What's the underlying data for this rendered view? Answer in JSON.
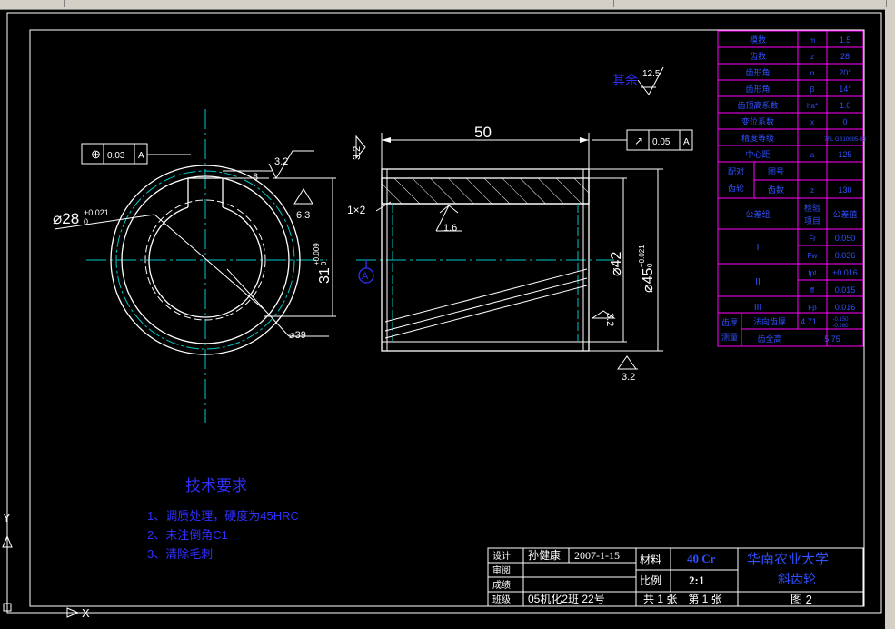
{
  "colors": {
    "background": "#000000",
    "geometry": "#ffffff",
    "centerline": "#00c8c8",
    "table": "#ff00ff",
    "annotation_blue": "#3030ff",
    "table_text": "#3050ff"
  },
  "dimensions": {
    "length": "50",
    "dia28": "⌀28",
    "dia28_tol_upper": "+0.021",
    "dia28_tol_lower": "0",
    "keyway_depth": "31",
    "keyway_tol_upper": "+0.009",
    "keyway_tol_lower": "0",
    "dia42": "⌀42",
    "dia45": "⌀45",
    "dia45_tol_upper": "+0.021",
    "dia45_tol_lower": "0",
    "dia39": "⌀39",
    "keyway_width": "8",
    "chamfer": "1×2"
  },
  "roughness": {
    "rest": "其余",
    "rest_value": "12.5",
    "top": "3.2",
    "left_face": "3.2",
    "keyway": "3.2",
    "keyway_side": "6.3",
    "bore": "1.6",
    "right_face": "3.2",
    "bottom": "3.2"
  },
  "tolerance_frames": {
    "circular_runout": {
      "symbol": "⊕",
      "value": "0.03",
      "datum": "A"
    },
    "runout": {
      "symbol": "↗",
      "value": "0.05",
      "datum": "A"
    }
  },
  "datum_label": "A",
  "gear_params": [
    {
      "label": "模数",
      "sym": "m",
      "val": "1.5"
    },
    {
      "label": "齿数",
      "sym": "z",
      "val": "28"
    },
    {
      "label": "齿形角",
      "sym": "α",
      "val": "20°"
    },
    {
      "label": "齿形角",
      "sym": "β",
      "val": "14°"
    },
    {
      "label": "齿顶高系数",
      "sym": "ha*",
      "val": "1.0"
    },
    {
      "label": "变位系数",
      "sym": "x",
      "val": "0"
    },
    {
      "label": "精度等级",
      "sym": "",
      "val": "7FL GB10095-88"
    },
    {
      "label": "中心距",
      "sym": "a",
      "val": "125"
    }
  ],
  "mating": {
    "label": "配对齿轮",
    "row1": "图号",
    "row2": "齿数",
    "row2_val": "130"
  },
  "tolerance_group": {
    "header_label": "公差组",
    "header_item": "检验项目",
    "header_value": "公差值",
    "groups": [
      {
        "name": "I",
        "items": [
          {
            "sym": "Fr",
            "val": "0.050"
          },
          {
            "sym": "Fw",
            "val": "0.036"
          }
        ]
      },
      {
        "name": "II",
        "items": [
          {
            "sym": "fpt",
            "val": "±0.016"
          },
          {
            "sym": "ff",
            "val": "0.015"
          }
        ]
      },
      {
        "name": "III",
        "items": [
          {
            "sym": "Fβ",
            "val": "0.016"
          }
        ]
      }
    ]
  },
  "tooth_thickness": {
    "label": "齿厚测量",
    "row1_label": "法向齿厚",
    "row1_val": "4.71",
    "row1_tol_upper": "-0.150",
    "row1_tol_lower": "-0.280",
    "row2_label": "齿全高",
    "row2_val": "5.75"
  },
  "tech_requirements": {
    "title": "技术要求",
    "items": [
      "1、调质处理，硬度为45HRC",
      "2、未注倒角C1",
      "3、清除毛刺"
    ]
  },
  "title_block": {
    "design_label": "设计",
    "designer": "孙健康",
    "date": "2007-1-15",
    "review_label": "审阅",
    "grade_label": "成绩",
    "class_label": "班级",
    "class_value": "05机化2班 22号",
    "material_label": "材料",
    "material": "40 Cr",
    "scale_label": "比例",
    "scale": "2:1",
    "sheets": "共 1 张　第 1 张",
    "school": "华南农业大学",
    "part_name": "斜齿轮",
    "figure_no": "图 2"
  },
  "ucs": {
    "x": "X",
    "y": "Y"
  }
}
